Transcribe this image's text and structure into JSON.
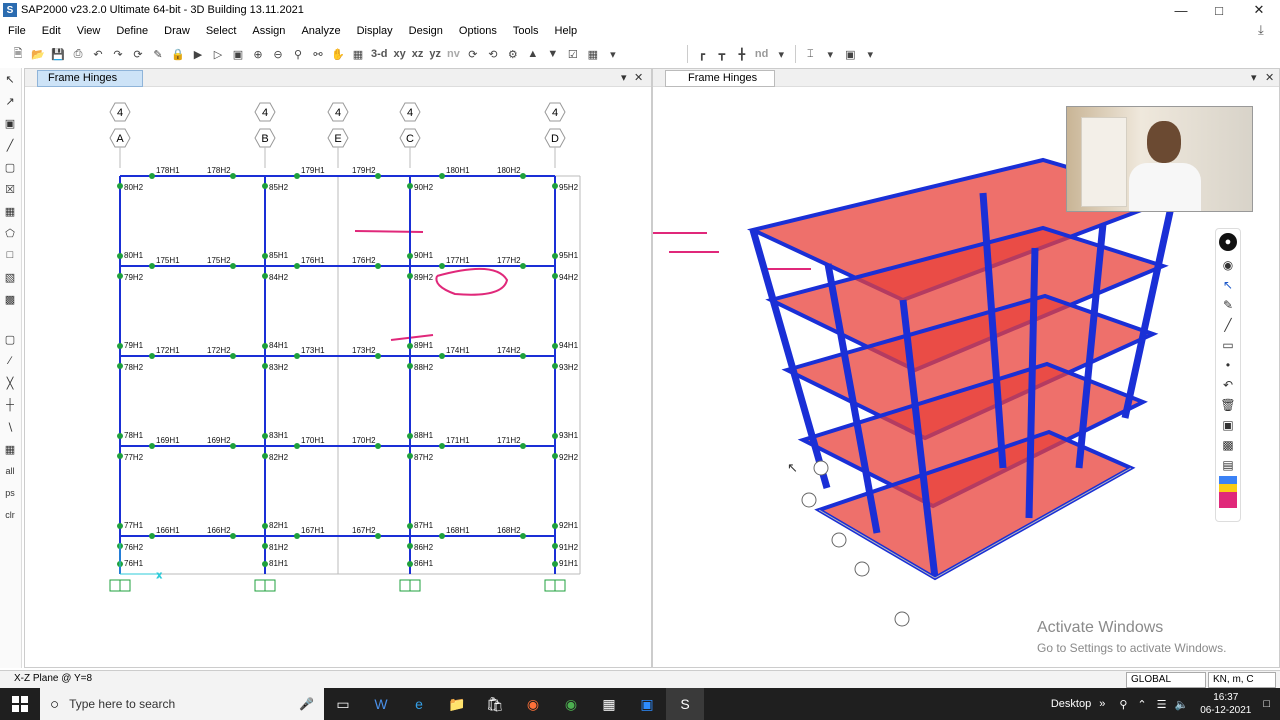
{
  "app": {
    "title": "SAP2000 v23.2.0 Ultimate 64-bit - 3D Building 13.11.2021",
    "icon_letter": "S"
  },
  "window_controls": [
    "minimize",
    "maximize",
    "close"
  ],
  "menu": [
    "File",
    "Edit",
    "View",
    "Define",
    "Draw",
    "Select",
    "Assign",
    "Analyze",
    "Display",
    "Design",
    "Options",
    "Tools",
    "Help"
  ],
  "toolbar": {
    "view_labels": [
      "3-d",
      "xy",
      "xz",
      "yz",
      "nv"
    ],
    "right_label": "nd"
  },
  "panes": {
    "left": {
      "tab": "Frame Hinges"
    },
    "right": {
      "tab": "Frame Hinges"
    }
  },
  "elevation": {
    "grid_top_number": "4",
    "grid_lines": [
      "A",
      "B",
      "E",
      "C",
      "D"
    ],
    "beam_labels": [
      [
        "178H1",
        "178H2",
        "179H1",
        "179H2",
        "180H1",
        "180H2"
      ],
      [
        "175H1",
        "175H2",
        "176H1",
        "176H2",
        "177H1",
        "177H2"
      ],
      [
        "172H1",
        "172H2",
        "173H1",
        "173H2",
        "174H1",
        "174H2"
      ],
      [
        "169H1",
        "169H2",
        "170H1",
        "170H2",
        "171H1",
        "171H2"
      ],
      [
        "166H1",
        "166H2",
        "167H1",
        "167H2",
        "168H1",
        "168H2"
      ]
    ],
    "column_labels": {
      "A": [
        "80H2",
        "80H1",
        "79H2",
        "79H1",
        "78H2",
        "78H1",
        "77H2",
        "77H1",
        "76H2",
        "76H1"
      ],
      "B": [
        "85H2",
        "85H1",
        "84H2",
        "84H1",
        "83H2",
        "83H1",
        "82H2",
        "82H1",
        "81H2",
        "81H1"
      ],
      "C": [
        "90H2",
        "90H1",
        "89H2",
        "89H1",
        "88H2",
        "88H1",
        "87H2",
        "87H1",
        "86H2",
        "86H1"
      ],
      "D": [
        "95H2",
        "95H1",
        "94H2",
        "94H1",
        "93H2",
        "93H1",
        "92H2",
        "92H1",
        "91H2",
        "91H1"
      ]
    }
  },
  "status": {
    "plane": "X-Z Plane @ Y=8",
    "coord_system": "GLOBAL",
    "units": "KN, m, C"
  },
  "watermark": {
    "line1": "Activate Windows",
    "line2": "Go to Settings to activate Windows."
  },
  "taskbar": {
    "search_placeholder": "Type here to search",
    "desktop_label": "Desktop",
    "time": "16:37",
    "date": "06-12-2021"
  },
  "colors": {
    "frame": "#1a2fd6",
    "hinge": "#1fa03c",
    "slab": "#e8403a",
    "annotation": "#e0287a",
    "tab_active": "#cde3f7"
  }
}
